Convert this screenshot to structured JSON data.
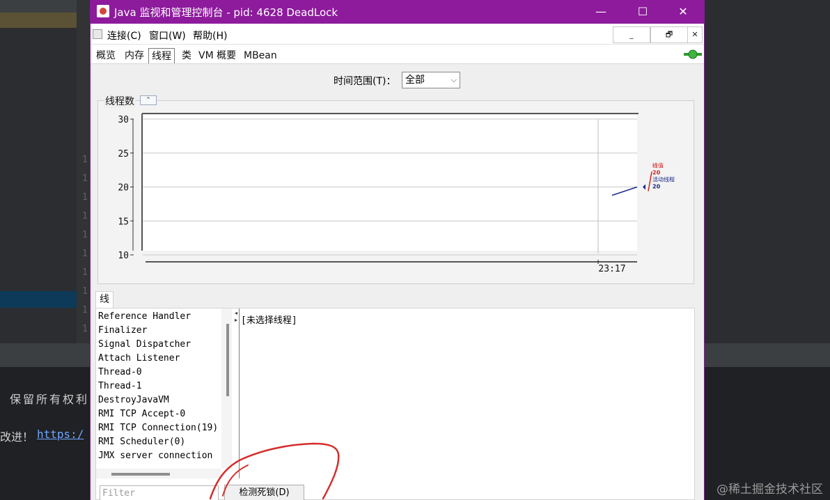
{
  "background": {
    "gutter_digits": [
      "1",
      "1",
      "1",
      "1",
      "1",
      "1",
      "1",
      "1",
      "1",
      "1"
    ],
    "rights_text": "保留所有权利",
    "link_prefix": "改进！",
    "link_text": "https:/",
    "watermark": "@稀土掘金技术社区"
  },
  "window": {
    "title": "Java 监视和管理控制台 - pid: 4628 DeadLock",
    "controls": {
      "minimize": "—",
      "maximize": "☐",
      "close": "✕"
    },
    "titlebar_color": "#8d1b9c"
  },
  "menubar": {
    "items": [
      "连接(C)",
      "窗口(W)",
      "帮助(H)"
    ],
    "inner_controls": [
      "_",
      "🗗",
      "✕"
    ]
  },
  "tabs": {
    "items": [
      "概览",
      "内存",
      "线程",
      "类",
      "VM 概要",
      "MBean"
    ],
    "selected": "线程"
  },
  "time_range": {
    "label": "时间范围(T)：",
    "value": "全部"
  },
  "chart_data": {
    "type": "line",
    "title": "线程数",
    "y_ticks": [
      "30",
      "25",
      "20",
      "15",
      "10"
    ],
    "ylim": [
      10,
      30
    ],
    "x_ticks": [
      "23:17"
    ],
    "series": [
      {
        "name": "峰值",
        "x": [
          "23:17"
        ],
        "values": [
          20
        ],
        "color": "#cc2222"
      },
      {
        "name": "活动线程",
        "x": [
          "23:17"
        ],
        "values": [
          20
        ],
        "color": "#1a2a8a"
      }
    ],
    "legend": [
      {
        "label": "峰值",
        "value": "20",
        "color": "#cc2222"
      },
      {
        "label": "活动线程",
        "value": "20",
        "color": "#1a2a8a"
      }
    ],
    "grid": true,
    "legend_position": "right"
  },
  "threads_section": {
    "tab": "线程",
    "threads": [
      "Reference Handler",
      "Finalizer",
      "Signal Dispatcher",
      "Attach Listener",
      "Thread-0",
      "Thread-1",
      "DestroyJavaVM",
      "RMI TCP Accept-0",
      "RMI TCP Connection(19)",
      "RMI Scheduler(0)",
      "JMX server connection"
    ],
    "detail_text": "[未选择线程]",
    "filter_placeholder": "Filter",
    "deadlock_button": "检测死锁(D)"
  }
}
